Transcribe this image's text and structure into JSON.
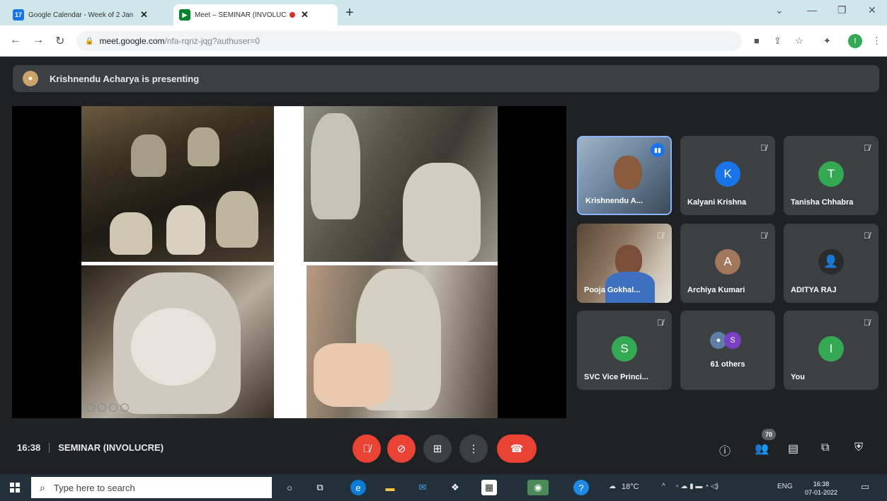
{
  "browser": {
    "tabs": [
      {
        "title": "Google Calendar - Week of 2 Jan",
        "favicon": "calendar-icon",
        "favicon_color": "#1a73e8",
        "favicon_text": "17"
      },
      {
        "title": "Meet – SEMINAR (INVOLUCRE)",
        "favicon": "meet-icon",
        "favicon_color": "#00832d",
        "active": true,
        "recording": true
      }
    ],
    "new_tab": "+",
    "address": {
      "host": "meet.google.com",
      "path": "/nfa-rqnz-jqg?authuser=0"
    },
    "profile_initial": "I",
    "profile_color": "#34a853"
  },
  "meet": {
    "presenter_banner": "Krishnendu Acharya is presenting",
    "participants": [
      {
        "name": "Krishnendu A...",
        "type": "camera",
        "speaking": true
      },
      {
        "name": "Kalyani Krishna",
        "initial": "K",
        "color": "#1a73e8",
        "muted": true
      },
      {
        "name": "Tanisha Chhabra",
        "initial": "T",
        "color": "#34a853",
        "muted": true
      },
      {
        "name": "Pooja Gokhal...",
        "type": "camera",
        "muted": true
      },
      {
        "name": "Archiya Kumari",
        "initial": "A",
        "color": "#a1785c",
        "muted": true
      },
      {
        "name": "ADITYA RAJ",
        "type": "photo",
        "muted": true
      },
      {
        "name": "SVC Vice Princi...",
        "initial": "S",
        "color": "#34a853",
        "muted": true
      },
      {
        "name": "61 others",
        "type": "group",
        "avatar_initial": "S",
        "avatar_color": "#7b3fc4"
      },
      {
        "name": "You",
        "initial": "I",
        "color": "#34a853",
        "muted": true
      }
    ],
    "time": "16:38",
    "meeting_title": "SEMINAR (INVOLUCRE)",
    "participant_count": "70",
    "accent_red": "#ea4335"
  },
  "taskbar": {
    "search_placeholder": "Type here to search",
    "weather": "18°C",
    "language": "ENG",
    "time": "16:38",
    "date": "07-01-2022"
  }
}
